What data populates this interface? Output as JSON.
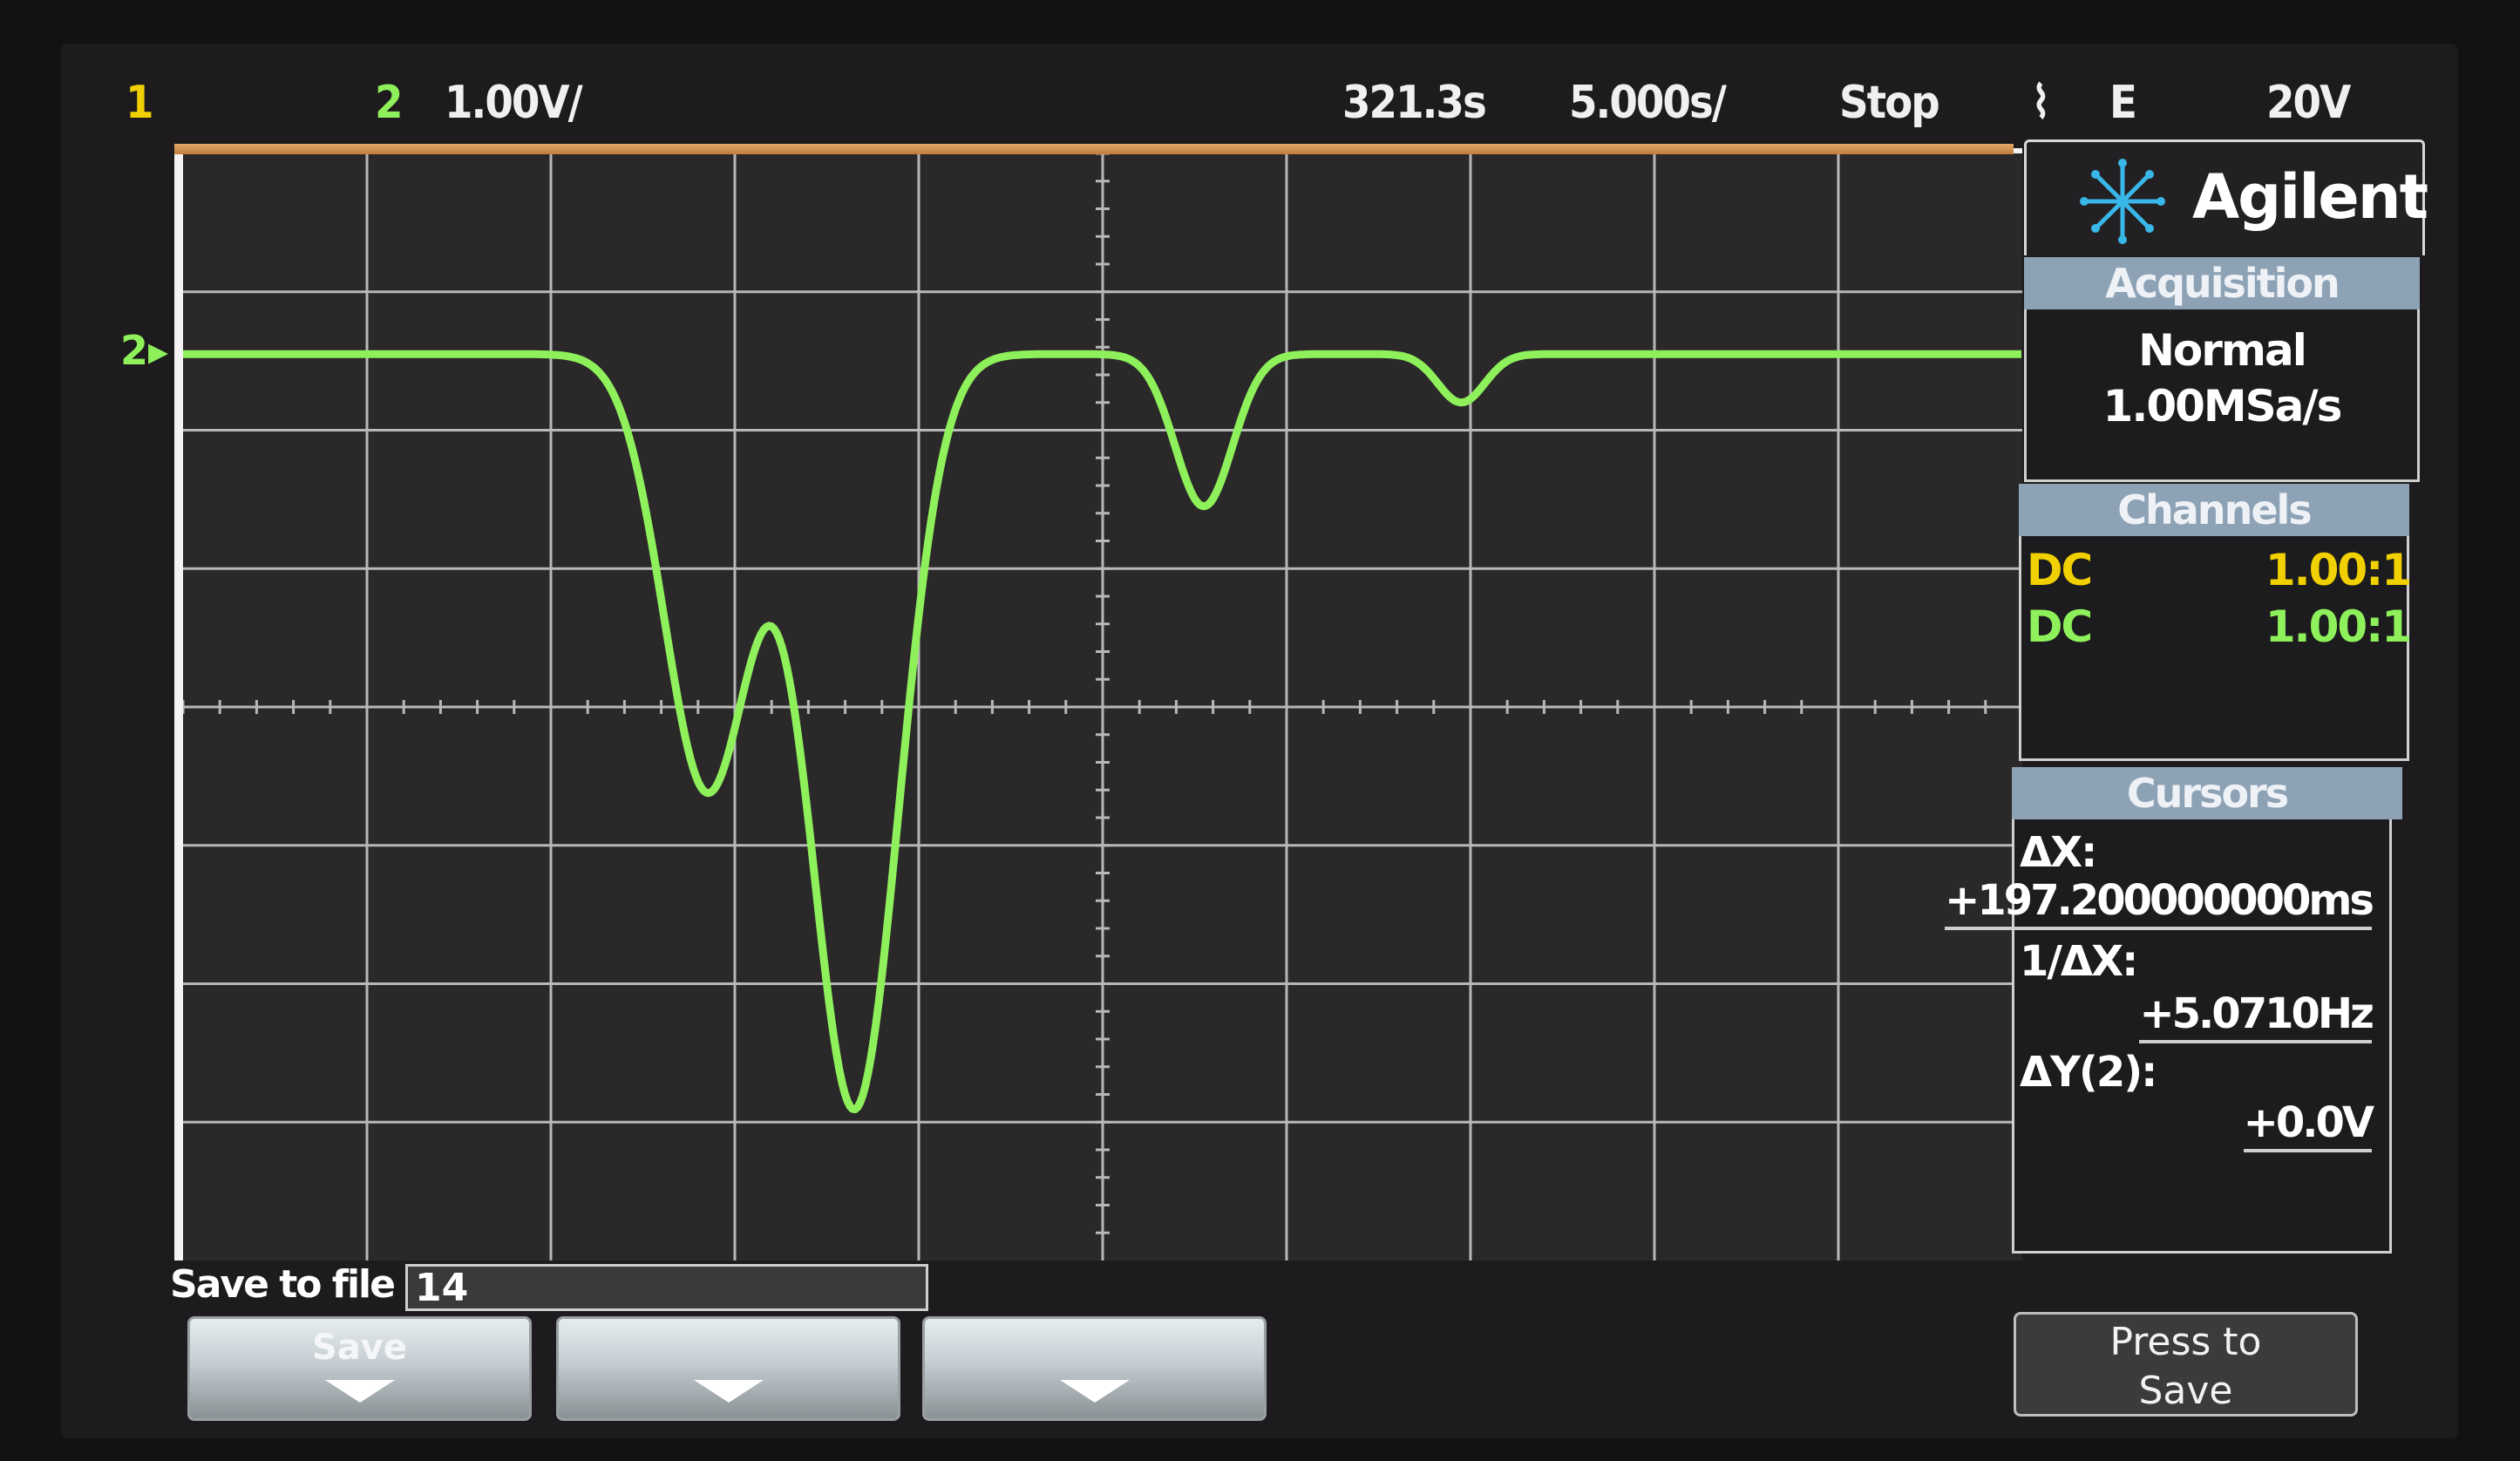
{
  "status_bar": {
    "ch1_indicator": "1",
    "ch2_indicator": "2",
    "ch2_scale": "1.00V/",
    "horizontal_position": "321.3s",
    "time_scale": "5.000s/",
    "run_state": "Stop",
    "trigger_mode": "E",
    "trigger_level": "20V"
  },
  "channel_marker": "2",
  "brand": "Agilent",
  "acquisition": {
    "header": "Acquisition",
    "mode": "Normal",
    "sample_rate": "1.00MSa/s"
  },
  "channels": {
    "header": "Channels",
    "rows": [
      {
        "coupling": "DC",
        "probe": "1.00:1"
      },
      {
        "coupling": "DC",
        "probe": "1.00:1"
      }
    ]
  },
  "cursors": {
    "header": "Cursors",
    "delta_x_label": "ΔX:",
    "delta_x_value": "+197.200000000ms",
    "inv_delta_x_label": "1/ΔX:",
    "inv_delta_x_value": "+5.0710Hz",
    "delta_y_label": "ΔY(2):",
    "delta_y_value": "+0.0V"
  },
  "save": {
    "label": "Save to file =",
    "filename": "14",
    "softkey1_label": "Save",
    "press_to_save_line1": "Press to",
    "press_to_save_line2": "Save"
  },
  "colors": {
    "ch1": "#f0d000",
    "ch2": "#8ef05a",
    "grid": "#b8b8b8",
    "background": "#2a2829"
  },
  "waveform": {
    "grid_divisions": {
      "horizontal": 10,
      "vertical": 8
    },
    "volts_per_div": 1.0,
    "baseline_div_from_top": 1.45,
    "dips": [
      {
        "center_div": 2.85,
        "depth_div": 3.15,
        "width_div": 0.33
      },
      {
        "center_div": 3.65,
        "depth_div": 5.45,
        "width_div": 0.34
      },
      {
        "center_div": 5.55,
        "depth_div": 1.1,
        "width_div": 0.22
      },
      {
        "center_div": 6.95,
        "depth_div": 0.35,
        "width_div": 0.18
      }
    ]
  }
}
